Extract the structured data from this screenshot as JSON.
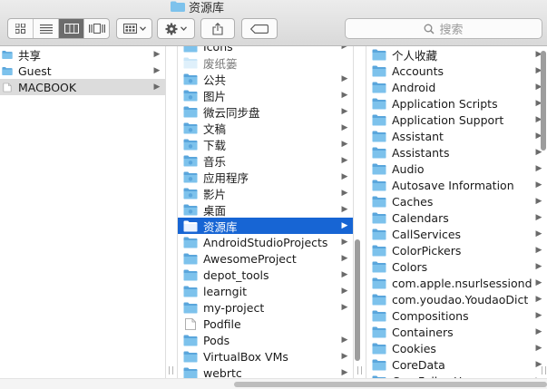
{
  "window": {
    "title": "资源库"
  },
  "search": {
    "placeholder": "搜索"
  },
  "icons": {
    "folder": "folder-icon",
    "special_folder": "system-folder-icon",
    "document": "document-icon",
    "trash": "trash-folder-icon",
    "colors": {
      "folder": "#7dc2ec",
      "folder_dark": "#5aa6dc",
      "selection": "#1765d4",
      "inactive_selection": "#dcdcdc"
    }
  },
  "columns": [
    {
      "items": [
        {
          "label": "共享",
          "icon": "folder",
          "arrow": true
        },
        {
          "label": "Guest",
          "icon": "folder",
          "arrow": true
        },
        {
          "label": "MACBOOK",
          "icon": "document",
          "arrow": true,
          "state": "inactive-selected"
        }
      ]
    },
    {
      "items": [
        {
          "label": "Icons",
          "icon": "folder",
          "arrow": true
        },
        {
          "label": "废纸篓",
          "icon": "trash",
          "arrow": false,
          "dimmed": true
        },
        {
          "label": "公共",
          "icon": "special_folder",
          "arrow": true
        },
        {
          "label": "图片",
          "icon": "special_folder",
          "arrow": true
        },
        {
          "label": "微云同步盘",
          "icon": "folder",
          "arrow": true
        },
        {
          "label": "文稿",
          "icon": "special_folder",
          "arrow": true
        },
        {
          "label": "下载",
          "icon": "special_folder",
          "arrow": true
        },
        {
          "label": "音乐",
          "icon": "special_folder",
          "arrow": true
        },
        {
          "label": "应用程序",
          "icon": "special_folder",
          "arrow": true
        },
        {
          "label": "影片",
          "icon": "special_folder",
          "arrow": true
        },
        {
          "label": "桌面",
          "icon": "special_folder",
          "arrow": true
        },
        {
          "label": "资源库",
          "icon": "folder",
          "arrow": true,
          "state": "selected"
        },
        {
          "label": "AndroidStudioProjects",
          "icon": "folder",
          "arrow": true
        },
        {
          "label": "AwesomeProject",
          "icon": "folder",
          "arrow": true
        },
        {
          "label": "depot_tools",
          "icon": "folder",
          "arrow": true
        },
        {
          "label": "learngit",
          "icon": "folder",
          "arrow": true
        },
        {
          "label": "my-project",
          "icon": "folder",
          "arrow": true
        },
        {
          "label": "Podfile",
          "icon": "document",
          "arrow": false
        },
        {
          "label": "Pods",
          "icon": "folder",
          "arrow": true
        },
        {
          "label": "VirtualBox VMs",
          "icon": "folder",
          "arrow": true
        },
        {
          "label": "webrtc",
          "icon": "folder",
          "arrow": true
        }
      ]
    },
    {
      "items": [
        {
          "label": "个人收藏",
          "icon": "folder",
          "arrow": true
        },
        {
          "label": "Accounts",
          "icon": "folder",
          "arrow": true
        },
        {
          "label": "Android",
          "icon": "folder",
          "arrow": true
        },
        {
          "label": "Application Scripts",
          "icon": "folder",
          "arrow": true
        },
        {
          "label": "Application Support",
          "icon": "folder",
          "arrow": true
        },
        {
          "label": "Assistant",
          "icon": "folder",
          "arrow": true
        },
        {
          "label": "Assistants",
          "icon": "folder",
          "arrow": true
        },
        {
          "label": "Audio",
          "icon": "folder",
          "arrow": true
        },
        {
          "label": "Autosave Information",
          "icon": "folder",
          "arrow": true
        },
        {
          "label": "Caches",
          "icon": "folder",
          "arrow": true
        },
        {
          "label": "Calendars",
          "icon": "folder",
          "arrow": true
        },
        {
          "label": "CallServices",
          "icon": "folder",
          "arrow": true
        },
        {
          "label": "ColorPickers",
          "icon": "folder",
          "arrow": true
        },
        {
          "label": "Colors",
          "icon": "folder",
          "arrow": true
        },
        {
          "label": "com.apple.nsurlsessiond",
          "icon": "folder",
          "arrow": true
        },
        {
          "label": "com.youdao.YoudaoDict",
          "icon": "folder",
          "arrow": true
        },
        {
          "label": "Compositions",
          "icon": "folder",
          "arrow": true
        },
        {
          "label": "Containers",
          "icon": "folder",
          "arrow": true
        },
        {
          "label": "Cookies",
          "icon": "folder",
          "arrow": true
        },
        {
          "label": "CoreData",
          "icon": "folder",
          "arrow": true
        },
        {
          "label": "CoreFollowUp",
          "icon": "folder",
          "arrow": true
        }
      ]
    }
  ]
}
